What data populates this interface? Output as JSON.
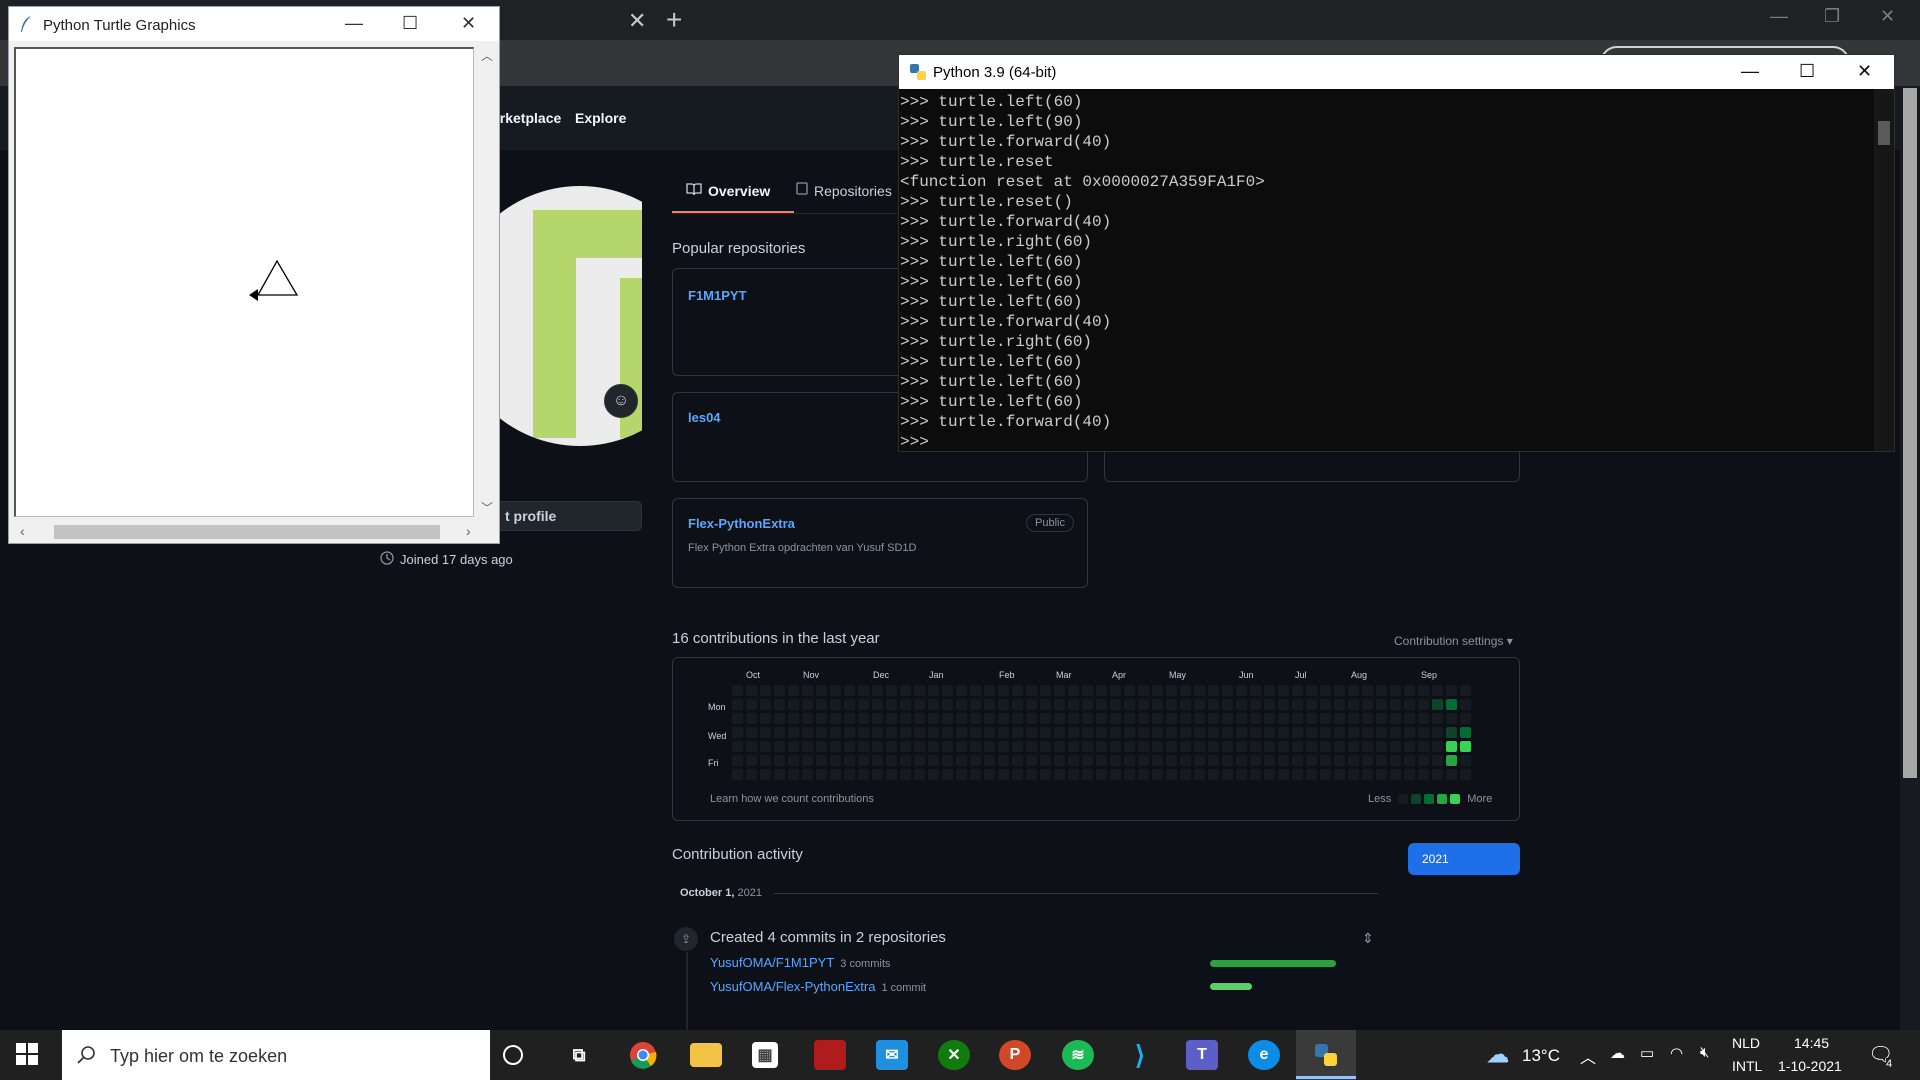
{
  "browser": {
    "tab_close": "✕",
    "new_tab": "+",
    "controls": [
      "—",
      "❐",
      "✕"
    ]
  },
  "github": {
    "nav": [
      "arketplace",
      "Explore"
    ],
    "tabs": [
      {
        "icon": "book-icon",
        "label": "Overview"
      },
      {
        "icon": "repo-icon",
        "label": "Repositories"
      }
    ],
    "edit_profile": "t profile",
    "joined": "Joined 17 days ago",
    "popular_title": "Popular repositories",
    "repos": [
      {
        "name": "F1M1PYT",
        "desc": ""
      },
      {
        "name": "les04",
        "desc": ""
      },
      {
        "name": "Flex-PythonExtra",
        "desc": "Flex Python Extra opdrachten van Yusuf SD1D",
        "badge": "Public"
      }
    ],
    "contrib_title": "16 contributions in the last year",
    "contrib_settings": "Contribution settings ▾",
    "months": [
      "Oct",
      "Nov",
      "Dec",
      "Jan",
      "Feb",
      "Mar",
      "Apr",
      "May",
      "Jun",
      "Jul",
      "Aug",
      "Sep"
    ],
    "days": [
      "Mon",
      "Wed",
      "Fri"
    ],
    "learn": "Learn how we count contributions",
    "legend_less": "Less",
    "legend_more": "More",
    "colors": {
      "level0": "#161b22",
      "level1": "#0e4429",
      "level2": "#006d32",
      "level3": "#26a641",
      "level4": "#39d353"
    },
    "activity_title": "Contribution activity",
    "year": "2021",
    "date_label": "October 1,",
    "date_year": "2021",
    "commits_title": "Created 4 commits in 2 repositories",
    "commit_rows": [
      {
        "repo": "YusufOMA/F1M1PYT",
        "count": "3 commits"
      },
      {
        "repo": "YusufOMA/Flex-PythonExtra",
        "count": "1 commit"
      }
    ]
  },
  "turtle": {
    "title": "Python Turtle Graphics",
    "controls": [
      "—",
      "☐",
      "✕"
    ]
  },
  "console": {
    "title": "Python 3.9 (64-bit)",
    "controls": [
      "—",
      "☐",
      "✕"
    ],
    "lines": [
      ">>> turtle.left(60)",
      ">>> turtle.left(90)",
      ">>> turtle.forward(40)",
      ">>> turtle.reset",
      "<function reset at 0x0000027A359FA1F0>",
      ">>> turtle.reset()",
      ">>> turtle.forward(40)",
      ">>> turtle.right(60)",
      ">>> turtle.left(60)",
      ">>> turtle.left(60)",
      ">>> turtle.left(60)",
      ">>> turtle.forward(40)",
      ">>> turtle.right(60)",
      ">>> turtle.left(60)",
      ">>> turtle.left(60)",
      ">>> turtle.left(60)",
      ">>> turtle.forward(40)",
      ">>>"
    ]
  },
  "taskbar": {
    "search_placeholder": "Typ hier om te zoeken",
    "weather": "13°C",
    "language": "NLD",
    "layout": "INTL",
    "time": "14:45",
    "date": "1-10-2021",
    "notifications": "4",
    "apps": [
      "cortana-icon",
      "task-view-icon",
      "chrome-icon",
      "file-explorer-icon",
      "store-icon",
      "app-red-icon",
      "mail-icon",
      "xbox-icon",
      "powerpoint-icon",
      "spotify-icon",
      "vscode-icon",
      "teams-icon",
      "edge-icon",
      "python-icon"
    ]
  }
}
